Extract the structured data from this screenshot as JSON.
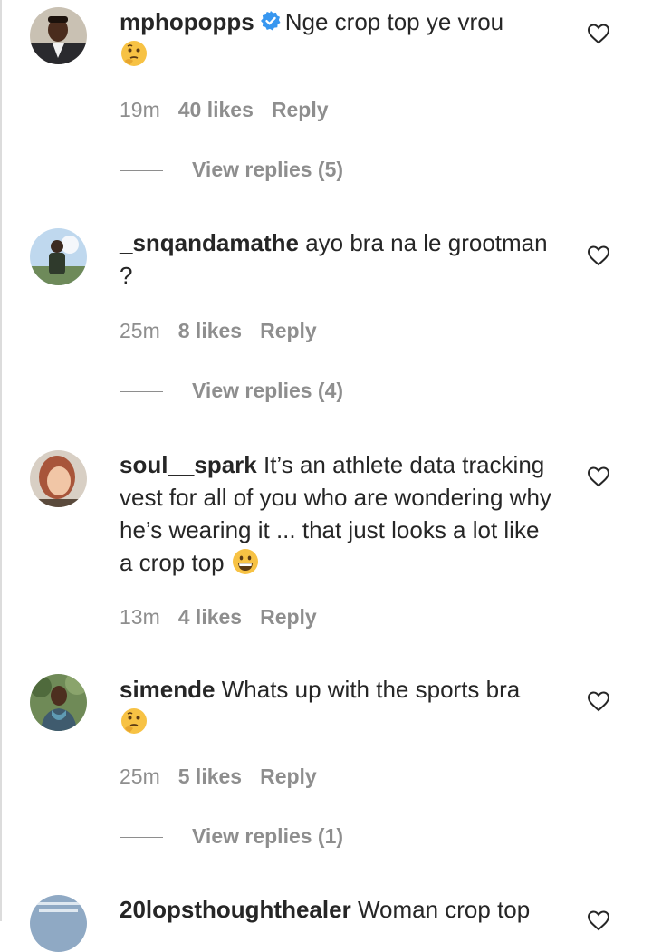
{
  "comments": [
    {
      "username": "mphopopps",
      "verified": true,
      "text": "Nge crop top ye vrou",
      "emoji": "thinking-face",
      "time": "19m",
      "likes": "40 likes",
      "reply": "Reply",
      "view_replies": "View replies (5)"
    },
    {
      "username": "_snqandamathe",
      "text": "ayo bra na le grootman ?",
      "time": "25m",
      "likes": "8 likes",
      "reply": "Reply",
      "view_replies": "View replies (4)"
    },
    {
      "username": "soul__spark",
      "text": "It’s an athlete data tracking vest for all of you who are wondering why he’s wearing it ... that just looks a lot like a crop top",
      "emoji": "grinning-face",
      "time": "13m",
      "likes": "4 likes",
      "reply": "Reply"
    },
    {
      "username": "simende",
      "text": "Whats up with the sports bra",
      "emoji": "thinking-face",
      "time": "25m",
      "likes": "5 likes",
      "reply": "Reply",
      "view_replies": "View replies (1)"
    },
    {
      "username": "20lopsthoughthealer",
      "text": "Woman crop top"
    }
  ],
  "colors": {
    "primary_text": "#262626",
    "secondary_text": "#8e8e8e",
    "verified_badge": "#3897f0"
  },
  "icons": {
    "like": "heart-outline-icon",
    "verified": "verified-badge-icon"
  }
}
